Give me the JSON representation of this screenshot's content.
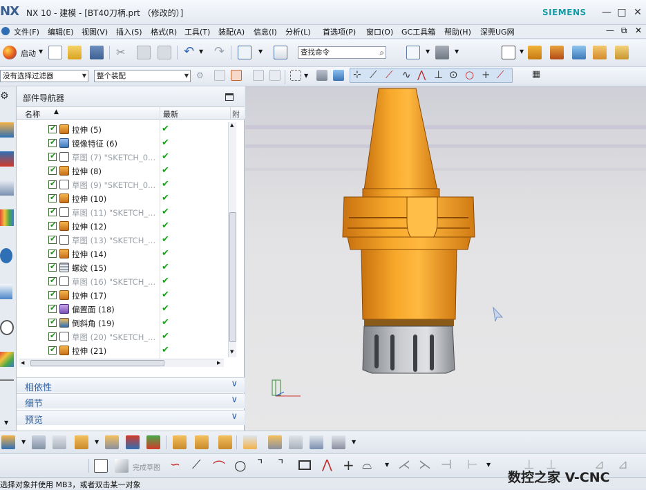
{
  "title_bar": {
    "logo": "NX",
    "title": "NX 10 - 建模 - [BT40刀柄.prt （修改的）]",
    "brand": "SIEMENS",
    "minimize": "—",
    "restore": "□",
    "close": "✕"
  },
  "menu_bar": {
    "items": [
      "文件(F)",
      "编辑(E)",
      "视图(V)",
      "插入(S)",
      "格式(R)",
      "工具(T)",
      "装配(A)",
      "信息(I)",
      "分析(L)",
      "首选项(P)",
      "窗口(O)",
      "GC工具箱",
      "帮助(H)",
      "深莞UG网"
    ],
    "win_controls": [
      "—",
      "⧉",
      "✕"
    ]
  },
  "toolbar1": {
    "start_label": "启动",
    "command_search_placeholder": "查找命令"
  },
  "toolbar2": {
    "selection_filter": "没有选择过滤器",
    "assembly_scope": "整个装配"
  },
  "navigator": {
    "title": "部件导航器",
    "col_name": "名称",
    "col_latest": "最新",
    "col_extra": "附",
    "rows": [
      {
        "label": "拉伸 (5)",
        "type": "extrude",
        "dim": false
      },
      {
        "label": "镜像特征 (6)",
        "type": "mirror",
        "dim": false
      },
      {
        "label": "草图 (7) \"SKETCH_0...",
        "type": "sketch",
        "dim": true
      },
      {
        "label": "拉伸 (8)",
        "type": "extrude",
        "dim": false
      },
      {
        "label": "草图 (9) \"SKETCH_0...",
        "type": "sketch",
        "dim": true
      },
      {
        "label": "拉伸 (10)",
        "type": "extrude",
        "dim": false
      },
      {
        "label": "草图 (11) \"SKETCH_...",
        "type": "sketch",
        "dim": true
      },
      {
        "label": "拉伸 (12)",
        "type": "extrude",
        "dim": false
      },
      {
        "label": "草图 (13) \"SKETCH_...",
        "type": "sketch",
        "dim": true
      },
      {
        "label": "拉伸 (14)",
        "type": "extrude",
        "dim": false
      },
      {
        "label": "螺纹 (15)",
        "type": "thread",
        "dim": false
      },
      {
        "label": "草图 (16) \"SKETCH_...",
        "type": "sketch",
        "dim": true
      },
      {
        "label": "拉伸 (17)",
        "type": "extrude",
        "dim": false
      },
      {
        "label": "偏置面 (18)",
        "type": "offset",
        "dim": false
      },
      {
        "label": "倒斜角 (19)",
        "type": "chamfer",
        "dim": false
      },
      {
        "label": "草图 (20) \"SKETCH_...",
        "type": "sketch",
        "dim": true
      },
      {
        "label": "拉伸 (21)",
        "type": "extrude",
        "dim": false
      }
    ],
    "panels": [
      "相依性",
      "细节",
      "预览"
    ]
  },
  "sketch_toolbar": {
    "finish_sketch": "完成草图"
  },
  "status_bar": {
    "message": "选择对象并使用 MB3，或者双击某一对象"
  },
  "watermark": "数控之家 V-CNC",
  "colors": {
    "accent": "#2d5fa0",
    "part_orange": "#f0a020",
    "check_green": "#1aa31a",
    "brand_teal": "#149ca5"
  }
}
